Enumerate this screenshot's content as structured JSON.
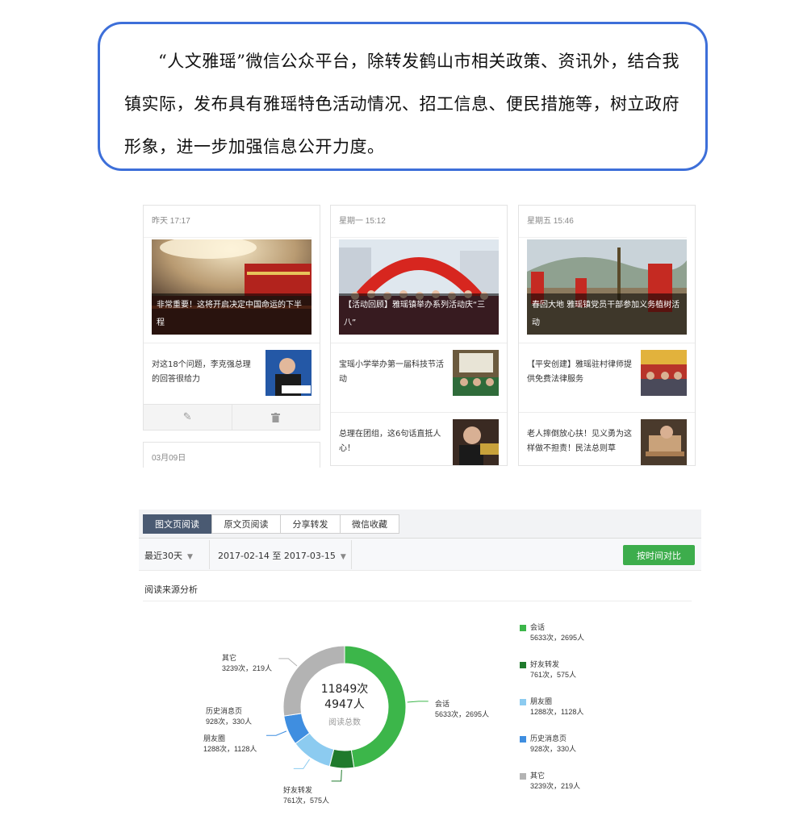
{
  "intro": {
    "text": "“人文雅瑶”微信公众平台，除转发鹤山市相关政策、资讯外，结合我镇实际，发布具有雅瑶特色活动情况、招工信息、便民措施等，树立政府形象，进一步加强信息公开力度。"
  },
  "articles": [
    {
      "date": "昨天 17:17",
      "main_title": "非常重要！这将开启决定中国命运的下半程",
      "sub_title": "对这18个问题，李克强总理的回答很给力",
      "actions": [
        "edit-icon",
        "trash-icon"
      ],
      "next_date": "03月09日"
    },
    {
      "date": "星期一 15:12",
      "main_title": "【活动回顾】雅瑶镇举办系列活动庆“三八”",
      "subs": [
        "宝瑶小学举办第一届科技节活动",
        "总理在团组，这6句话直抵人心！"
      ]
    },
    {
      "date": "星期五 15:46",
      "main_title": "春回大地 雅瑶镇党员干部参加义务植树活动",
      "subs": [
        "【平安创建】雅瑶驻村律师提供免费法律服务",
        "老人摔倒放心扶！见义勇为这样做不担责！民法总则草"
      ]
    }
  ],
  "stats": {
    "tabs": [
      "图文页阅读",
      "原文页阅读",
      "分享转发",
      "微信收藏"
    ],
    "active_tab": 0,
    "range_label": "最近30天",
    "date_range": "2017-02-14 至 2017-03-15",
    "compare_button": "按时间对比",
    "section_title": "阅读来源分析"
  },
  "chart_data": {
    "type": "pie",
    "title": "",
    "center_total_views": "11849次",
    "center_total_users": "4947人",
    "center_caption": "阅读总数",
    "series": [
      {
        "name": "会话",
        "views": 5633,
        "users": 2695,
        "label": "5633次，2695人",
        "color": "#3cb64a"
      },
      {
        "name": "好友转发",
        "views": 761,
        "users": 575,
        "label": "761次，575人",
        "color": "#1f7a2c"
      },
      {
        "name": "朋友圈",
        "views": 1288,
        "users": 1128,
        "label": "1288次，1128人",
        "color": "#8ccbf0"
      },
      {
        "name": "历史消息页",
        "views": 928,
        "users": 330,
        "label": "928次，330人",
        "color": "#3f8ee0"
      },
      {
        "name": "其它",
        "views": 3239,
        "users": 219,
        "label": "3239次，219人",
        "color": "#b3b3b3"
      }
    ],
    "legend_position": "right"
  }
}
